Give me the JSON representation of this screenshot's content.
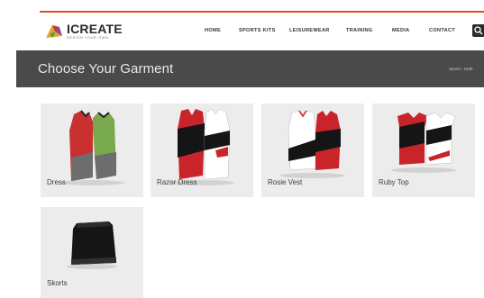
{
  "brand": {
    "name": "ICREATE",
    "tagline": "DESIGN YOUR OWN",
    "accent": "#d9531e"
  },
  "nav": {
    "items": [
      "HOME",
      "SPORTS KITS",
      "LEISUREWEAR",
      "TRAINING",
      "MEDIA",
      "CONTACT"
    ],
    "search_icon": "search-icon"
  },
  "banner": {
    "title": "Choose Your Garment",
    "breadcrumb": "Sports › Netb"
  },
  "garments": [
    {
      "label": "Dress"
    },
    {
      "label": "Razor Dress"
    },
    {
      "label": "Rosie Vest"
    },
    {
      "label": "Ruby Top"
    },
    {
      "label": "Skorts"
    }
  ]
}
